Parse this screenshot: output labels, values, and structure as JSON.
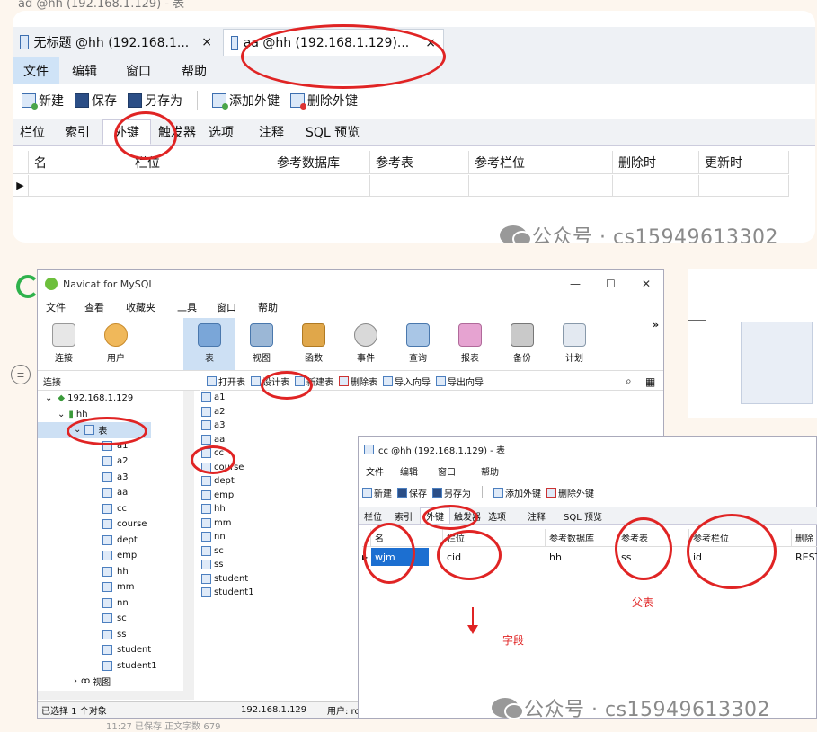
{
  "top_strip_text": "ad @hh (192.168.1.129) - 表",
  "top": {
    "tabs": [
      {
        "label": "无标题 @hh (192.168.1...",
        "close": "×"
      },
      {
        "label": "aa @hh (192.168.1.129)...",
        "close": "×"
      }
    ],
    "menu": [
      "文件",
      "编辑",
      "窗口",
      "帮助"
    ],
    "toolbar": {
      "new": "新建",
      "save": "保存",
      "saveas": "另存为",
      "addfk": "添加外键",
      "delfk": "删除外键"
    },
    "subtabs": [
      "栏位",
      "索引",
      "外键",
      "触发器",
      "选项",
      "注释",
      "SQL 预览"
    ],
    "columns": [
      "名",
      "栏位",
      "参考数据库",
      "参考表",
      "参考栏位",
      "删除时",
      "更新时"
    ],
    "row_marker": "▶"
  },
  "watermark": "公众号 · cs15949613302",
  "navicat": {
    "title": "Navicat for MySQL",
    "win_controls": [
      "—",
      "☐",
      "✕"
    ],
    "menu": [
      "文件",
      "查看",
      "收藏夹",
      "工具",
      "窗口",
      "帮助"
    ],
    "tools": [
      "连接",
      "用户",
      "表",
      "视图",
      "函数",
      "事件",
      "查询",
      "报表",
      "备份",
      "计划"
    ],
    "more": "»",
    "conn_label": "连接",
    "objbar": [
      "打开表",
      "设计表",
      "新建表",
      "删除表",
      "导入向导",
      "导出向导"
    ],
    "tree": {
      "server": "192.168.1.129",
      "db": "hh",
      "tables_node": "表",
      "tables": [
        "a1",
        "a2",
        "a3",
        "aa",
        "cc",
        "course",
        "dept",
        "emp",
        "hh",
        "mm",
        "nn",
        "sc",
        "ss",
        "student",
        "student1"
      ],
      "views_node": "视图"
    },
    "list": [
      "a1",
      "a2",
      "a3",
      "aa",
      "cc",
      "course",
      "dept",
      "emp",
      "hh",
      "mm",
      "nn",
      "sc",
      "ss",
      "student",
      "student1"
    ],
    "status": {
      "selected": "已选择 1 个对象",
      "server": "192.168.1.129",
      "user": "用户: ro"
    },
    "below": "11:27  已保存   正文字数  679"
  },
  "cc": {
    "title": "cc @hh (192.168.1.129) - 表",
    "menu": [
      "文件",
      "编辑",
      "窗口",
      "帮助"
    ],
    "toolbar": {
      "new": "新建",
      "save": "保存",
      "saveas": "另存为",
      "addfk": "添加外键",
      "delfk": "删除外键"
    },
    "subtabs": [
      "栏位",
      "索引",
      "外键",
      "触发器",
      "选项",
      "注释",
      "SQL 预览"
    ],
    "columns": [
      "名",
      "栏位",
      "参考数据库",
      "参考表",
      "参考栏位",
      "删除"
    ],
    "row": {
      "name": "wjm",
      "field": "cid",
      "refdb": "hh",
      "reftable": "ss",
      "refcol": "id",
      "ondelete": "REST"
    },
    "annotations": {
      "parent": "父表",
      "field": "字段"
    }
  },
  "colors": {
    "accent": "#e02424",
    "selected": "#cde0f4",
    "highlight": "#1c6fd1"
  }
}
